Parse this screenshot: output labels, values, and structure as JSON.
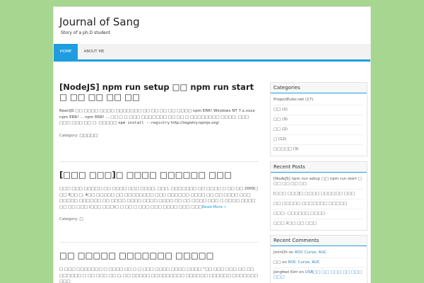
{
  "site": {
    "title": "Journal of Sang",
    "description": "Story of a ph.D student"
  },
  "nav": {
    "items": [
      {
        "label": "HOME"
      },
      {
        "label": "ABOUT ME"
      }
    ]
  },
  "posts": [
    {
      "title": "[NodeJS] npm run setup □□ npm run start □ □□ □□ □□ □□",
      "excerpt_text": "ReactJS □□ □□□□ □□□□ □□□□□□□ □□ □□ □□ □□ □□□□ npm ERR! Windows NT 7.x.xxxx npm ERR! ... npm ERR! ... □□ □ □ □□□ □□□□□□□ □□ □□ □ □□□□□□□□ □□□□; □□□ □□□ □□□ □□ □. □□□□□ ",
      "excerpt_code": "npm install --registry",
      "excerpt_tail": " http://registry.npmjs.org/",
      "category_label": "Category: ",
      "category": "□□□□□"
    },
    {
      "title": "[□□□ □□□]□ □□□□ □□□□□□ □□□",
      "excerpt_text": "□□□ □□□ □□□□□ □□ □□□□ □□□ □□□□, □□□, □□□□□□□ □□ □□□□ □ □□ □□ 2009□ □□ 3□□ □, 4□□ □□□□□ □□ □□□□□□□□ □□□ □□□□□□ □□□□ □□ □□ □□□□ □□□ □□□□□ □□□□□□ □□ □□□□ □□□□ □□□□ □□□□ □□ □□ □□□□ □□□ □ □□□□ □□□□ □□ □□ □□□ (□□□ □□□)□ □ □□ □ □□□ □□□ □□□□ □□□ □□□",
      "read_more": "Read More »",
      "category_label": "Category: ",
      "category": "□"
    },
    {
      "title": "□□ □□□□□ □□□□□□□ □□□□□",
      "excerpt_text": "□ □□□ □□□□□□□ □ □□□□ □□ □ □ □□□ □□□□ □□□□ □□□□ “□□ □□□ □□□ □□ □□ □□□□□□ □ □□ □□□ □□ □, □□ □□□□□ □□□□□□□□□ □□□□□□ □□□□□□ □□□□□□□ □□□"
    }
  ],
  "sidebar": {
    "categories": {
      "title": "Categories",
      "items": [
        {
          "name": "ProjectEuler.net",
          "count": "(17)"
        },
        {
          "name": "□□",
          "count": "(1)"
        },
        {
          "name": "□□",
          "count": "(3)"
        },
        {
          "name": "□□",
          "count": "(2)"
        },
        {
          "name": "□",
          "count": "(12)"
        },
        {
          "name": "□□□□□",
          "count": "(3)"
        }
      ]
    },
    "recent_posts": {
      "title": "Recent Posts",
      "items": [
        {
          "title": "[NodeJS] npm run setup □□ npm run start □ □□ □□ □□ □□"
        },
        {
          "title": "[□□□ □□□]□ □□□□ □□□□□□ □□□"
        },
        {
          "title": "□□ □□□□□ □□□□□□□ □□□□□"
        },
        {
          "title": "□□□- □□□□□□ □□□□"
        },
        {
          "title": "□□□ 2□□ □□ □□□"
        }
      ]
    },
    "recent_comments": {
      "title": "Recent Comments",
      "items": [
        {
          "author": "JminOh",
          "on": " on ",
          "post": "ROC Curve, AUC"
        },
        {
          "author": "□□",
          "on": " on ",
          "post": "ROC Curve, AUC"
        },
        {
          "author": "Jongfeel Kim",
          "on": " on ",
          "post": "USB□□ □□ □□□ □□ □□□ □□□"
        }
      ]
    }
  }
}
